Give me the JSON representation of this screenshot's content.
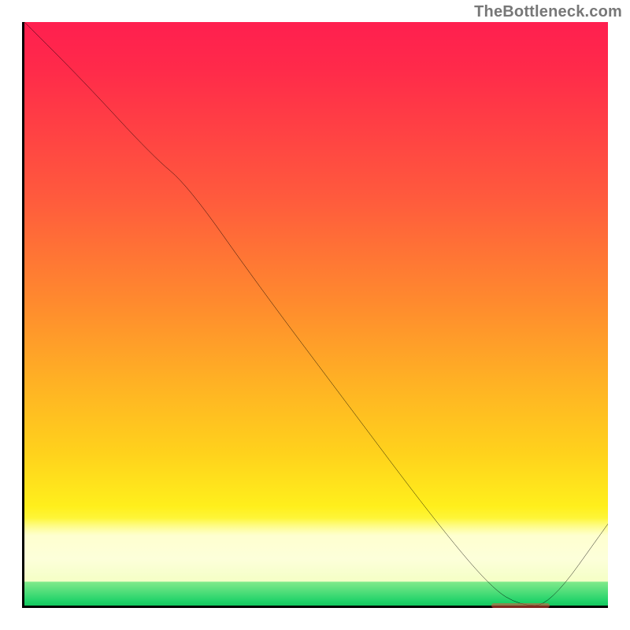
{
  "attribution": "TheBottleneck.com",
  "chart_data": {
    "type": "line",
    "title": "",
    "xlabel": "",
    "ylabel": "",
    "xlim": [
      0,
      100
    ],
    "ylim": [
      0,
      100
    ],
    "grid": false,
    "legend": false,
    "series": [
      {
        "name": "curve",
        "x": [
          0,
          10,
          22,
          28,
          40,
          55,
          70,
          80,
          85,
          90,
          100
        ],
        "values": [
          100,
          90,
          77,
          72,
          55,
          35,
          15,
          3,
          0,
          0,
          14
        ]
      }
    ],
    "flat_segment": {
      "x_start": 80,
      "x_end": 90,
      "y": 0
    },
    "background_gradient": {
      "stops": [
        {
          "pos": 0.0,
          "color": "#ff1f4f"
        },
        {
          "pos": 0.3,
          "color": "#ff5a3d"
        },
        {
          "pos": 0.62,
          "color": "#ffb224"
        },
        {
          "pos": 0.83,
          "color": "#ffef1c"
        },
        {
          "pos": 0.93,
          "color": "#fbffae"
        },
        {
          "pos": 0.96,
          "color": "#f6ffca"
        },
        {
          "pos": 0.965,
          "color": "#7fe98a"
        },
        {
          "pos": 1.0,
          "color": "#13c85e"
        }
      ]
    }
  }
}
